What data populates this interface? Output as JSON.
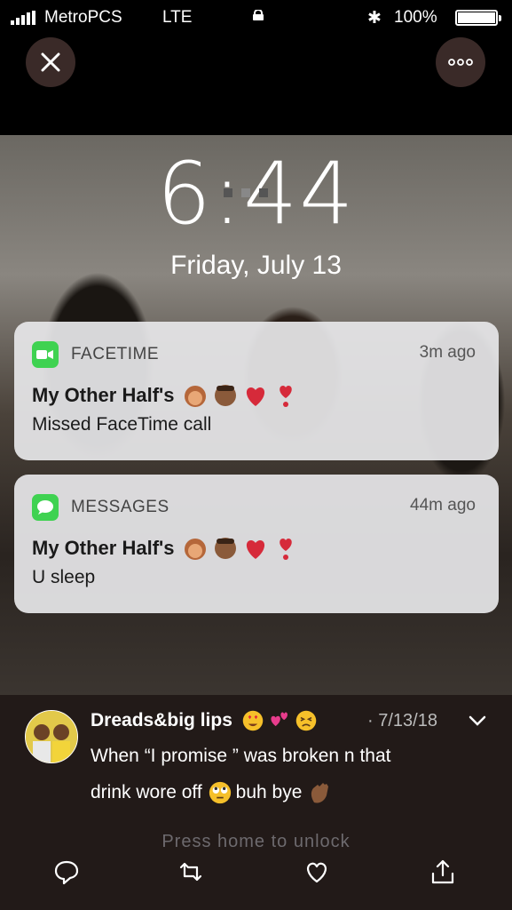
{
  "status_bar": {
    "carrier": "MetroPCS",
    "network": "LTE",
    "bluetooth_glyph": "✱",
    "battery_percent": "100%",
    "battery_level": 1.0
  },
  "top_buttons": {
    "close_glyph": "✕",
    "more_glyph": "ooo"
  },
  "lock_screen": {
    "time": "6:44",
    "date": "Friday, July 13",
    "unlock_hint": "Press home to unlock"
  },
  "notifications": [
    {
      "app": "FACETIME",
      "age": "3m ago",
      "title": "My Other Half's",
      "body": "Missed FaceTime call",
      "icon": "facetime-icon",
      "emoji": [
        "girl-emoji",
        "boy-emoji",
        "heart-emoji",
        "heart-exclamation-emoji"
      ]
    },
    {
      "app": "MESSAGES",
      "age": "44m ago",
      "title": "My Other Half's",
      "body": "U sleep",
      "icon": "messages-icon",
      "emoji": [
        "girl-emoji",
        "boy-emoji",
        "heart-emoji",
        "heart-exclamation-emoji"
      ]
    }
  ],
  "tweet": {
    "username": "Dreads&big lips",
    "username_emoji": [
      "heart-eyes-emoji",
      "two-hearts-emoji",
      "persevering-face-emoji"
    ],
    "date": "· 7/13/18",
    "text_line1": "When “I promise ” was broken n that",
    "text_line2_a": "drink wore off",
    "text_line2_b": "buh bye",
    "text_emoji": [
      "eye-roll-emoji",
      "waving-hand-emoji"
    ]
  },
  "colors": {
    "background": "#000000",
    "tweet_bar": "#221a18",
    "notification_bg": "#e6e6e8",
    "app_green": "#3fd251",
    "button_bg": "#3a2a28"
  }
}
